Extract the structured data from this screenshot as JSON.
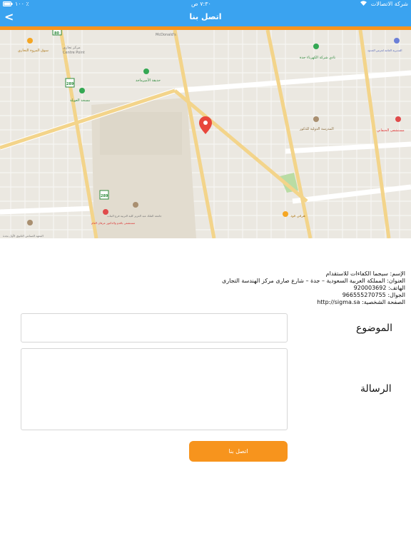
{
  "status_bar": {
    "carrier": "شركة الاتصالات",
    "time": "٧:٣٠ ص",
    "battery": "١٠٠ ٪",
    "wifi_icon": "wifi-icon",
    "battery_icon": "battery-icon"
  },
  "nav": {
    "title": "اتصل بنا",
    "back_icon": "chevron-left-icon",
    "back_glyph": "<"
  },
  "map": {
    "labels": {
      "mcdonalds": "McDonald's",
      "garden": "حديقة الأميرماجد",
      "market": "سوق المروة التجاري",
      "center": "مركز تجاري",
      "center_sub": "Centre Point",
      "mosque": "مسجد العويلة",
      "university": "جامعة الملك عبد العزيز كلية التربية فرع البنات",
      "club": "نادي شركة الكهرباء جدة",
      "school": "المدرسة الدولية للذكور",
      "hospital": "مستشفى الحنفاني",
      "directorate": "المديرية العامة لحرس الحدود",
      "institute": "المعهد الصناعي الثانوي الأول بجدة",
      "hospital2": "مستشفى باقدو والدكتور عرفان العام",
      "restaurant": "هرفي فود",
      "road_289a": "289",
      "road_289b": "289",
      "road_80": "80"
    },
    "marker_icon": "map-pin-icon"
  },
  "info": {
    "name_label": "الإسم:",
    "name_value": "سيجما الكفاءات للاستقدام",
    "address_label": "العنوان:",
    "address_value": "المملكة العربية السعودية – جدة – شارع صارى مركز الهندسة التجارى",
    "phone_label": "الهاتف:",
    "phone_value": "920003692",
    "mobile_label": "الجوال:",
    "mobile_value": "966555270755",
    "website_label": "الصفحة الشخصية:",
    "website_value": "http://sigma.sa"
  },
  "form": {
    "subject_label": "الموضوع",
    "subject_value": "",
    "message_label": "الرسالة",
    "message_value": "",
    "submit_label": "اتصل بنا"
  },
  "colors": {
    "header": "#3aa3f0",
    "accent": "#f7941d"
  }
}
